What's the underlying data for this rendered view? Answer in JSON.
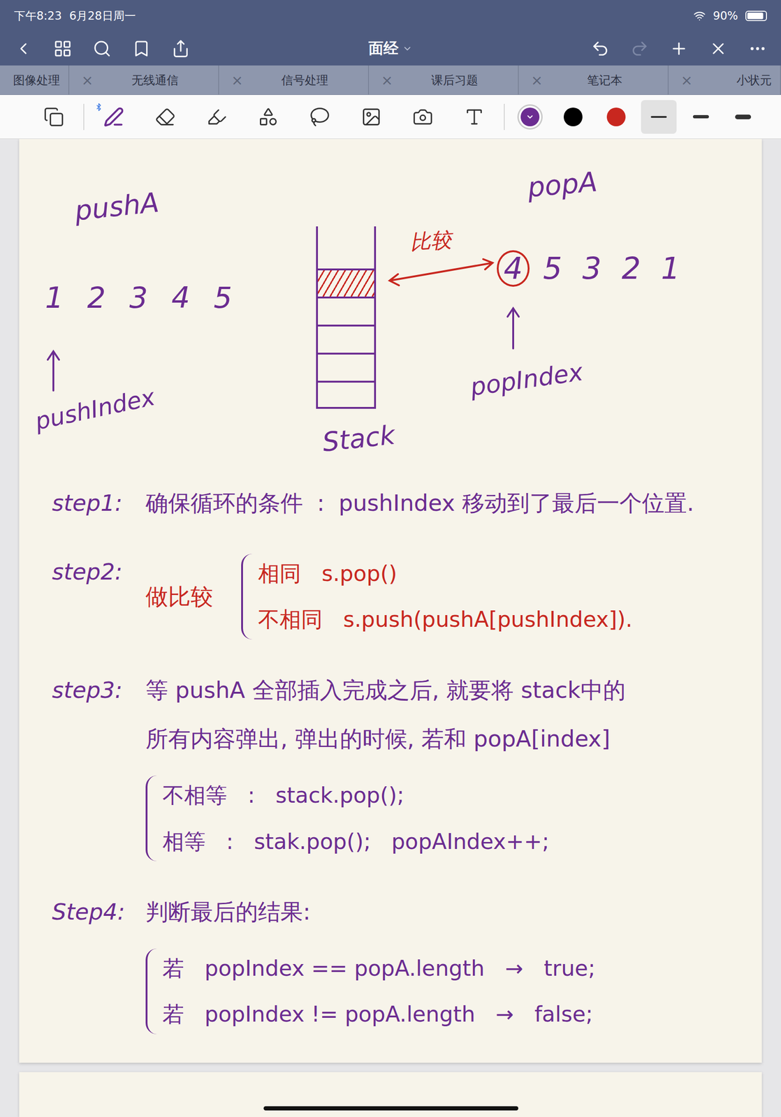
{
  "status_bar": {
    "time": "下午8:23",
    "date": "6月28日周一",
    "battery": "90%",
    "battery_level": 0.9
  },
  "nav": {
    "title": "面经",
    "redo_disabled": true
  },
  "tabs": [
    {
      "label": "图像处理",
      "selected": false,
      "close": ""
    },
    {
      "label": "无线通信",
      "selected": false,
      "close": "×"
    },
    {
      "label": "信号处理",
      "selected": false,
      "close": "×"
    },
    {
      "label": "课后习题",
      "selected": false,
      "close": "×"
    },
    {
      "label": "笔记本",
      "selected": false,
      "close": "×"
    },
    {
      "label": "小状元",
      "selected": false,
      "close": "×"
    }
  ],
  "toolbar": {
    "tools": [
      {
        "kind": "pages",
        "selected": false
      },
      {
        "kind": "pen",
        "selected": true,
        "bluetooth": true
      },
      {
        "kind": "eraser",
        "selected": false
      },
      {
        "kind": "highlighter",
        "selected": false
      },
      {
        "kind": "shapes",
        "selected": false
      },
      {
        "kind": "lasso",
        "selected": false
      },
      {
        "kind": "image",
        "selected": false
      },
      {
        "kind": "camera",
        "selected": false
      },
      {
        "kind": "text",
        "selected": false
      }
    ],
    "colors": [
      {
        "color": "#6b2c91",
        "selected": true
      },
      {
        "color": "#000000",
        "selected": false
      },
      {
        "color": "#c8271f",
        "selected": false
      }
    ],
    "widths": [
      {
        "selected": true
      },
      {
        "selected": false
      },
      {
        "selected": false
      }
    ]
  },
  "note": {
    "diagram": {
      "push_label": "pushA",
      "push_values": [
        "1",
        "2",
        "3",
        "4",
        "5"
      ],
      "push_index": "pushIndex",
      "stack_label": "Stack",
      "stack_cells": [
        {
          "filled": true
        },
        {
          "filled": false
        },
        {
          "filled": false
        },
        {
          "filled": false
        },
        {
          "filled": false
        }
      ],
      "compare": "比较",
      "pop_label": "popA",
      "pop_values": [
        {
          "text": "4",
          "circled": true
        },
        {
          "text": "5",
          "circled": false
        },
        {
          "text": "3",
          "circled": false
        },
        {
          "text": "2",
          "circled": false
        },
        {
          "text": "1",
          "circled": false
        }
      ],
      "pop_index": "popIndex"
    },
    "steps": [
      {
        "label": "step1:",
        "kind": "none",
        "lines": [
          [
            {
              "text": "确保循环的条件",
              "color": "#6b2c91"
            },
            {
              "text": ":",
              "color": "#6b2c91"
            },
            {
              "text": "pushIndex 移动到了最后一个位置.",
              "color": "#6b2c91"
            }
          ]
        ],
        "branches": []
      },
      {
        "label": "step2:",
        "kind": "inline",
        "lines": [
          [
            {
              "text": "做比较",
              "color": "#c8271f"
            }
          ]
        ],
        "branches": [
          {
            "cells": [
              "相同",
              "s.pop()"
            ],
            "color": "#c8271f"
          },
          {
            "cells": [
              "不相同",
              "s.push(pushA[pushIndex])."
            ],
            "color": "#c8271f"
          }
        ]
      },
      {
        "label": "step3:",
        "kind": "stacked",
        "lines": [
          [
            {
              "text": "等 pushA 全部插入完成之后, 就要将 stack中的",
              "color": "#6b2c91"
            }
          ],
          [
            {
              "text": "所有内容弹出, 弹出的时候, 若和 popA[index]",
              "color": "#6b2c91"
            }
          ]
        ],
        "branches": [
          {
            "cells": [
              "不相等",
              ":",
              "stack.pop();"
            ],
            "color": "#6b2c91"
          },
          {
            "cells": [
              "相等",
              ":",
              "stak.pop();",
              "popAIndex++;"
            ],
            "color": "#6b2c91"
          }
        ]
      },
      {
        "label": "Step4:",
        "kind": "stacked",
        "lines": [
          [
            {
              "text": "判断最后的结果:",
              "color": "#6b2c91"
            }
          ]
        ],
        "branches": [
          {
            "cells": [
              "若",
              "popIndex == popA.length",
              "→",
              "true;"
            ],
            "color": "#6b2c91"
          },
          {
            "cells": [
              "若",
              "popIndex != popA.length",
              "→",
              "false;"
            ],
            "color": "#6b2c91"
          }
        ]
      }
    ]
  }
}
